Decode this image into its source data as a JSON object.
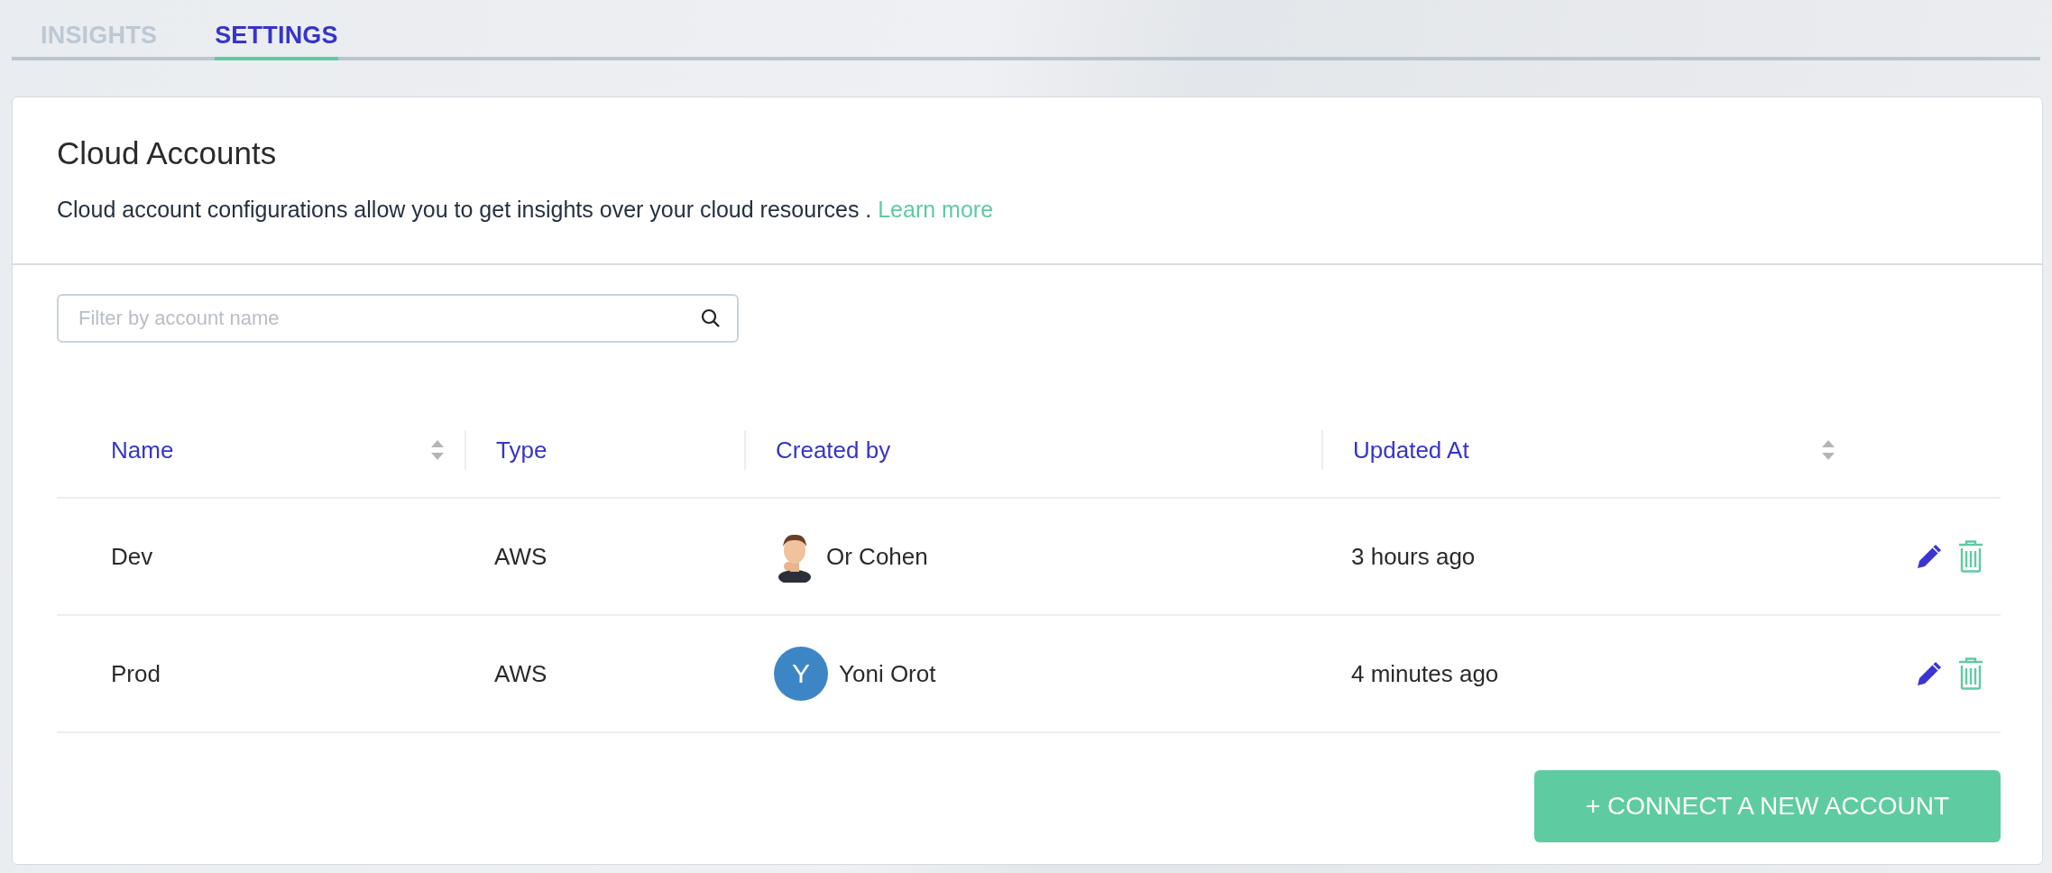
{
  "tabs": [
    {
      "label": "INSIGHTS",
      "selected": false
    },
    {
      "label": "SETTINGS",
      "selected": true
    }
  ],
  "card": {
    "title": "Cloud Accounts",
    "description": "Cloud account configurations allow you to get insights over your cloud resources .",
    "link": "Learn more"
  },
  "search": {
    "placeholder": "Filter by account name"
  },
  "table": {
    "columns": [
      {
        "label": "Name",
        "sortable": true
      },
      {
        "label": "Type",
        "sortable": false
      },
      {
        "label": "Created by",
        "sortable": false
      },
      {
        "label": "Updated At",
        "sortable": true
      }
    ],
    "rows": [
      {
        "name": "Dev",
        "type": "AWS",
        "created_by": {
          "name": "Or Cohen"
        },
        "updated_at": "3 hours ago"
      },
      {
        "name": "Prod",
        "type": "AWS",
        "created_by": {
          "name": "Yoni Orot",
          "avatar": {
            "kind": "initial",
            "initial": "Y"
          }
        },
        "updated_at": "4 minutes ago"
      }
    ]
  },
  "primary_button": "+ CONNECT A NEW ACCOUNT"
}
